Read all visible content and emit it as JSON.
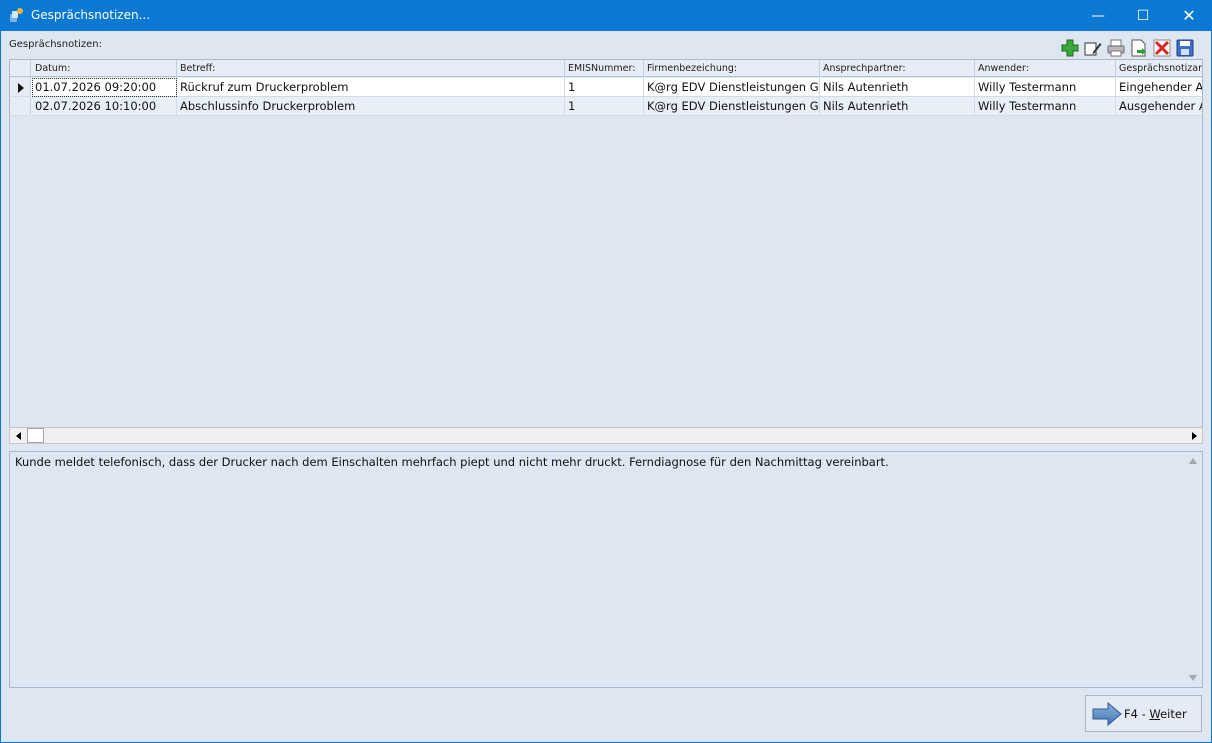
{
  "window": {
    "title": "Gesprächsnotizen...",
    "icon": "app-icon",
    "controls": {
      "minimize": "—",
      "maximize": "☐",
      "close": "✕"
    }
  },
  "grid": {
    "label": "Gesprächsnotizen:",
    "toolbar": [
      {
        "name": "add-icon",
        "label": "Neu"
      },
      {
        "name": "edit-icon",
        "label": "Bearbeiten"
      },
      {
        "name": "print-icon",
        "label": "Drucken"
      },
      {
        "name": "export-icon",
        "label": "Exportieren"
      },
      {
        "name": "delete-icon",
        "label": "Löschen"
      },
      {
        "name": "save-icon",
        "label": "Speichern"
      }
    ],
    "columns": [
      "Datum:",
      "Betreff:",
      "EMISNummer:",
      "Firmenbezeichung:",
      "Ansprechpartner:",
      "Anwender:",
      "Gesprächsnotizar"
    ],
    "rows": [
      [
        "01.07.2026 09:20:00",
        "Rückruf zum Druckerproblem",
        "1",
        "K@rg EDV Dienstleistungen Gm",
        "Nils Autenrieth",
        "Willy Testermann",
        "Eingehender Ar"
      ],
      [
        "02.07.2026 10:10:00",
        "Abschlussinfo Druckerproblem",
        "1",
        "K@rg EDV Dienstleistungen Gm",
        "Nils Autenrieth",
        "Willy Testermann",
        "Ausgehender Ar"
      ]
    ],
    "selected_row": 0
  },
  "notes": {
    "text": "Kunde meldet telefonisch, dass der Drucker nach dem Einschalten mehrfach piept und nicht mehr druckt. Ferndiagnose für den Nachmittag vereinbart."
  },
  "footer": {
    "next_key": "F4 - ",
    "next_accel": "W",
    "next_rest": "eiter"
  },
  "colors": {
    "titlebar": "#0b78d4",
    "background": "#dde6f1",
    "selected_row": "#ffffff"
  }
}
